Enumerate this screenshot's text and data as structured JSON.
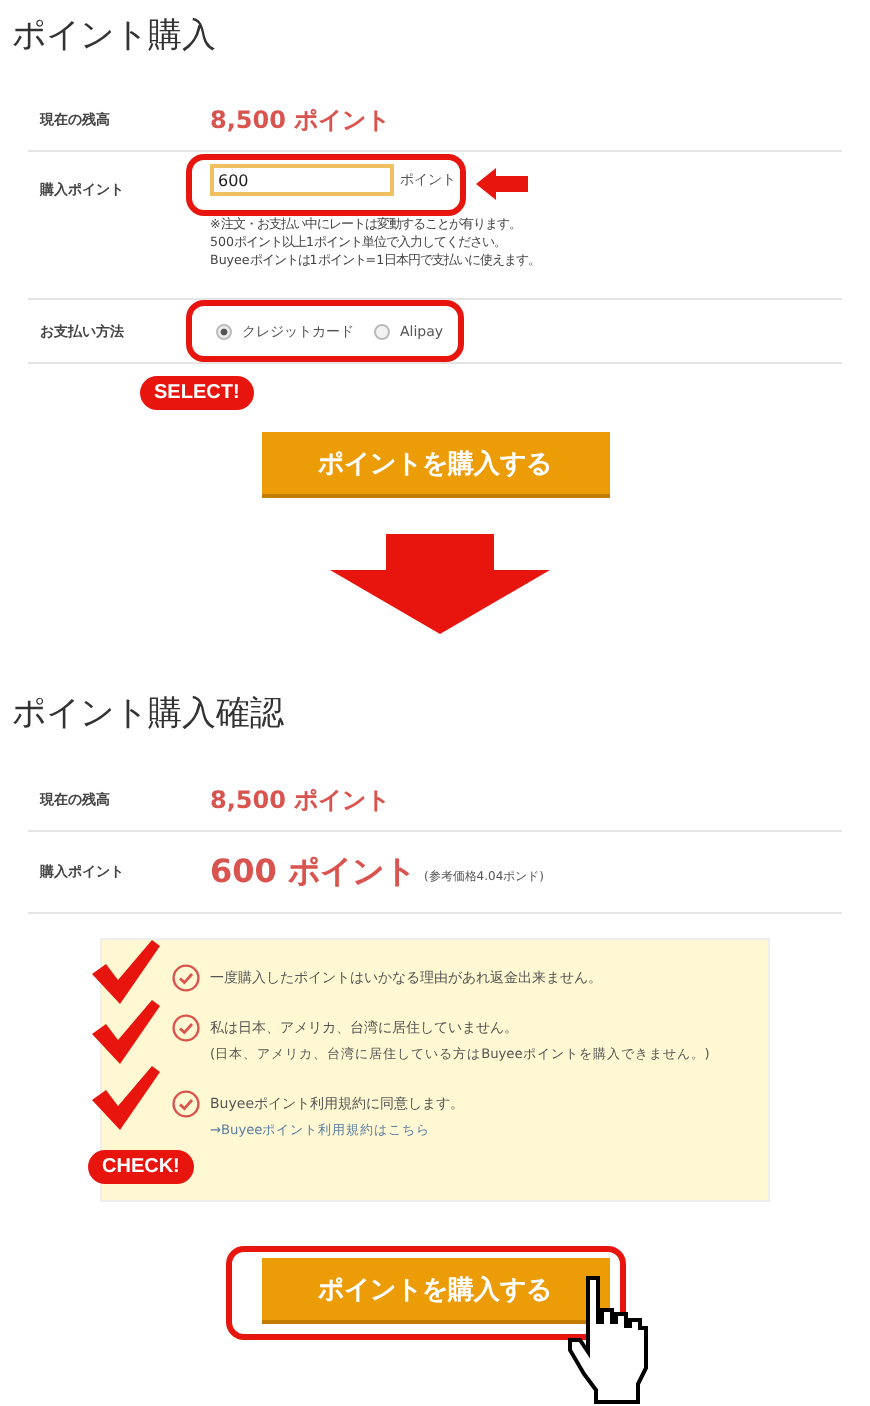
{
  "purchase_form": {
    "title": "ポイント購入",
    "balance": {
      "label": "現在の残高",
      "value": "8,500 ポイント"
    },
    "amount": {
      "label": "購入ポイント",
      "value": "600",
      "unit": "ポイント",
      "notes": [
        "※注文・お支払い中にレートは変動することが有ります。",
        "500ポイント以上1ポイント単位で入力してください。",
        "Buyeeポイントは1ポイント=1日本円で支払いに使えます。"
      ]
    },
    "payment": {
      "label": "お支払い方法",
      "options": [
        {
          "label": "クレジットカード",
          "selected": true
        },
        {
          "label": "Alipay",
          "selected": false
        }
      ]
    },
    "submit": "ポイントを購入する"
  },
  "annotations": {
    "select_badge": "SELECT!",
    "check_badge": "CHECK!"
  },
  "confirmation": {
    "title": "ポイント購入確認",
    "balance": {
      "label": "現在の残高",
      "value": "8,500 ポイント"
    },
    "amount": {
      "label": "購入ポイント",
      "value": "600 ポイント",
      "reference": "(参考価格4.04ポンド)"
    },
    "agreements": [
      {
        "text": "一度購入したポイントはいかなる理由があれ返金出来ません。",
        "checked": true
      },
      {
        "text": "私は日本、アメリカ、台湾に居住していません。",
        "note": "(日本、アメリカ、台湾に居住している方はBuyeeポイントを購入できません。)",
        "checked": true
      },
      {
        "text": "Buyeeポイント利用規約に同意します。",
        "link": "→Buyeeポイント利用規約はこちら",
        "checked": true
      }
    ],
    "submit": "ポイントを購入する"
  }
}
